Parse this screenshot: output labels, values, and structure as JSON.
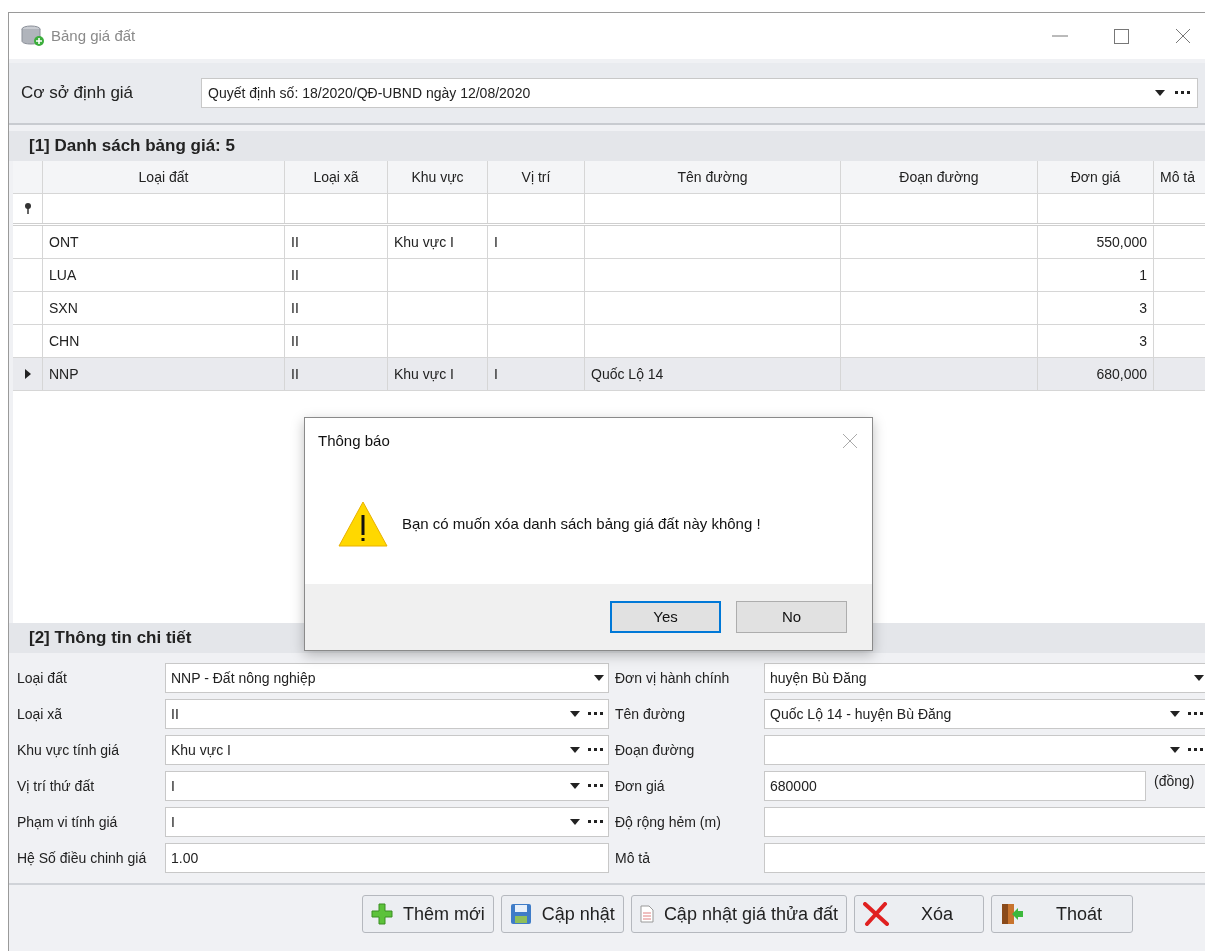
{
  "window": {
    "title": "Bảng giá đất"
  },
  "basis": {
    "label": "Cơ sở định giá",
    "value": "Quyết định số: 18/2020/QĐ-UBND ngày 12/08/2020"
  },
  "list": {
    "title": "[1] Danh sách bảng giá: 5",
    "columns": [
      {
        "label": "Loại đất"
      },
      {
        "label": "Loại xã"
      },
      {
        "label": "Khu vực"
      },
      {
        "label": "Vị trí"
      },
      {
        "label": "Tên đường"
      },
      {
        "label": "Đoạn đường"
      },
      {
        "label": "Đơn giá"
      },
      {
        "label": "Mô tả"
      }
    ],
    "rows": [
      {
        "selected": false,
        "cells": [
          "ONT",
          "II",
          "Khu vực I",
          "I",
          "",
          "",
          "550,000",
          ""
        ]
      },
      {
        "selected": false,
        "cells": [
          "LUA",
          "II",
          "",
          "",
          "",
          "",
          "1",
          ""
        ]
      },
      {
        "selected": false,
        "cells": [
          "SXN",
          "II",
          "",
          "",
          "",
          "",
          "3",
          ""
        ]
      },
      {
        "selected": false,
        "cells": [
          "CHN",
          "II",
          "",
          "",
          "",
          "",
          "3",
          ""
        ]
      },
      {
        "selected": true,
        "cells": [
          "NNP",
          "II",
          "Khu vực I",
          "I",
          "Quốc Lộ 14",
          "",
          "680,000",
          ""
        ]
      }
    ]
  },
  "detail": {
    "title": "[2] Thông tin chi tiết",
    "left_fields": [
      {
        "label": "Loại đất",
        "value": "NNP - Đất nông nghiệp",
        "kind": "combo"
      },
      {
        "label": "Loại xã",
        "value": "II",
        "kind": "combo_more"
      },
      {
        "label": "Khu vực tính giá",
        "value": "Khu vực I",
        "kind": "combo_more"
      },
      {
        "label": "Vị trí thứ đất",
        "value": "I",
        "kind": "combo_more"
      },
      {
        "label": "Phạm vi tính giá",
        "value": "I",
        "kind": "combo_more"
      },
      {
        "label": "Hệ Số điều chinh giá",
        "value": "1.00",
        "kind": "text"
      }
    ],
    "right_fields": [
      {
        "label": "Đơn vị hành chính",
        "value": "huyện Bù Đăng",
        "kind": "combo"
      },
      {
        "label": "Tên đường",
        "value": "Quốc Lộ 14 - huyện Bù Đăng",
        "kind": "combo_more"
      },
      {
        "label": "Đoạn đường",
        "kind": "combo_more"
      },
      {
        "label": "Đơn giá",
        "value": "680000",
        "kind": "text",
        "suffix": "(đồng)"
      },
      {
        "label": "Độ rộng hẻm (m)",
        "kind": "text"
      },
      {
        "label": "Mô tả",
        "kind": "text"
      }
    ]
  },
  "buttons": [
    {
      "label": "Thêm mới",
      "kind": "add"
    },
    {
      "label": "Cập nhật",
      "kind": "save"
    },
    {
      "label": "Cập nhật giá thửa đất",
      "kind": "document"
    },
    {
      "label": "Xóa",
      "kind": "delete"
    },
    {
      "label": "Thoát",
      "kind": "exit"
    }
  ],
  "dialog": {
    "title": "Thông báo",
    "message": "Bạn có muốn xóa danh sách bảng giá đất này không !",
    "buttons": [
      {
        "label": "Yes",
        "default": true
      },
      {
        "label": "No",
        "default": false
      }
    ]
  }
}
